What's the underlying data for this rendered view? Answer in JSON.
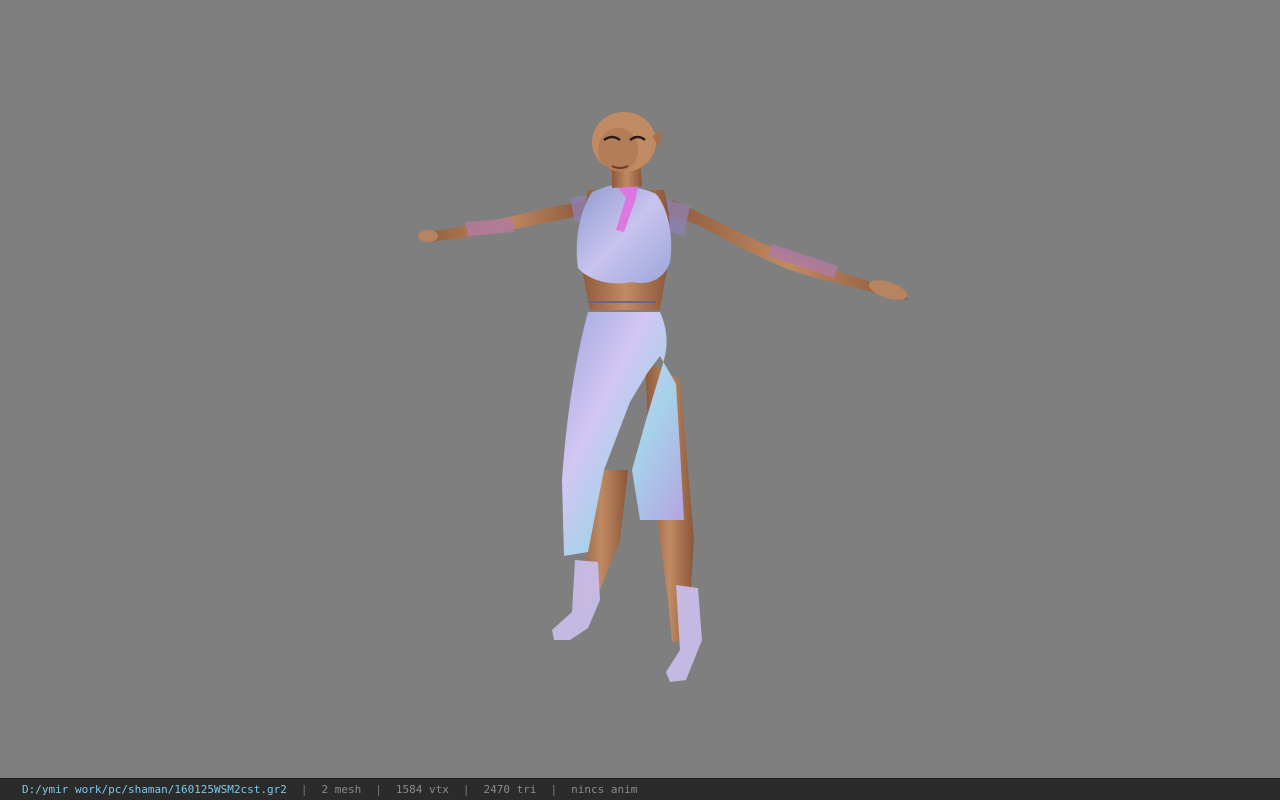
{
  "viewport": {
    "background_color": "#7f7f7f",
    "model": {
      "skin_color": "#b37a55",
      "dress_color": "#b8b7e6",
      "accent_color": "#e070e0"
    }
  },
  "statusbar": {
    "file_path": "D:/ymir work/pc/shaman/160125WSM2cst.gr2",
    "separator": "|",
    "mesh_count": "2 mesh",
    "vertex_count": "1584 vtx",
    "triangle_count": "2470 tri",
    "anim_info": "nincs anim"
  }
}
